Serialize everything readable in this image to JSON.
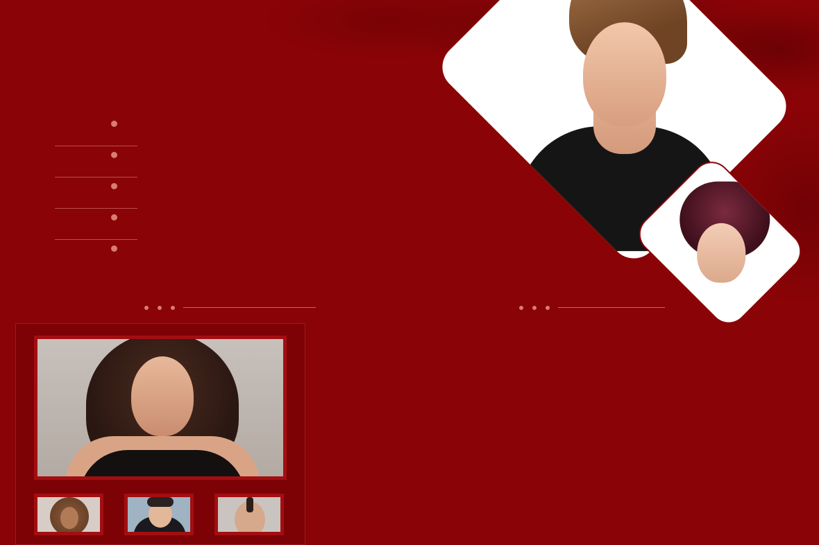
{
  "colors": {
    "background": "#8a0306",
    "accent_dot": "#d97d6e",
    "frame": "#a30e12",
    "panel": "#7d0205"
  },
  "nav": {
    "items": [
      {
        "label": ""
      },
      {
        "label": ""
      },
      {
        "label": ""
      },
      {
        "label": ""
      },
      {
        "label": ""
      }
    ]
  },
  "hero": {
    "large_image": "model-updo-portrait",
    "small_image": "model-curly-updo-portrait"
  },
  "gallery": {
    "main_image": "model-long-hair-portrait",
    "thumbnails": [
      {
        "image": "curly-afro-portrait"
      },
      {
        "image": "man-spiky-hair-portrait"
      },
      {
        "image": "mohawk-portrait"
      }
    ]
  }
}
